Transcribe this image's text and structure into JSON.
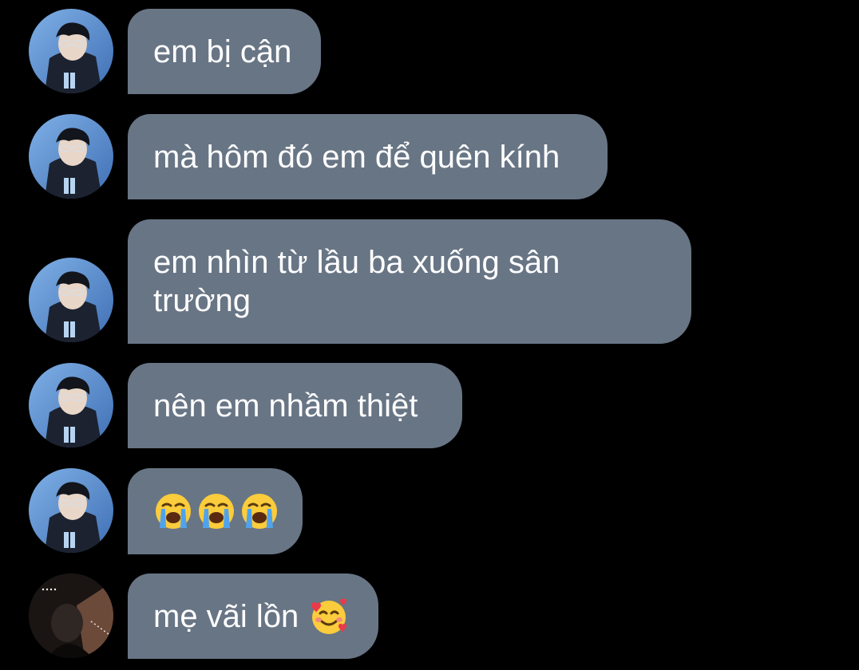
{
  "colors": {
    "background": "#000000",
    "bubble": "#687585",
    "text": "#ffffff",
    "avatar_a_sky": "#5a8fd0",
    "avatar_b_bg": "#2a2420"
  },
  "messages": [
    {
      "avatar": "avatar-a",
      "text": "em bị cận"
    },
    {
      "avatar": "avatar-a",
      "text": "mà hôm đó em để quên kính"
    },
    {
      "avatar": "avatar-a",
      "text": "em nhìn từ lầu ba xuống sân\ntrường"
    },
    {
      "avatar": "avatar-a",
      "text": "nên em nhầm thiệt"
    },
    {
      "avatar": "avatar-a",
      "emojis": [
        "loudly-crying-face",
        "loudly-crying-face",
        "loudly-crying-face"
      ]
    },
    {
      "avatar": "avatar-b",
      "text": "mẹ vãi lồn",
      "trailing_emoji": "smiling-face-with-hearts"
    }
  ]
}
